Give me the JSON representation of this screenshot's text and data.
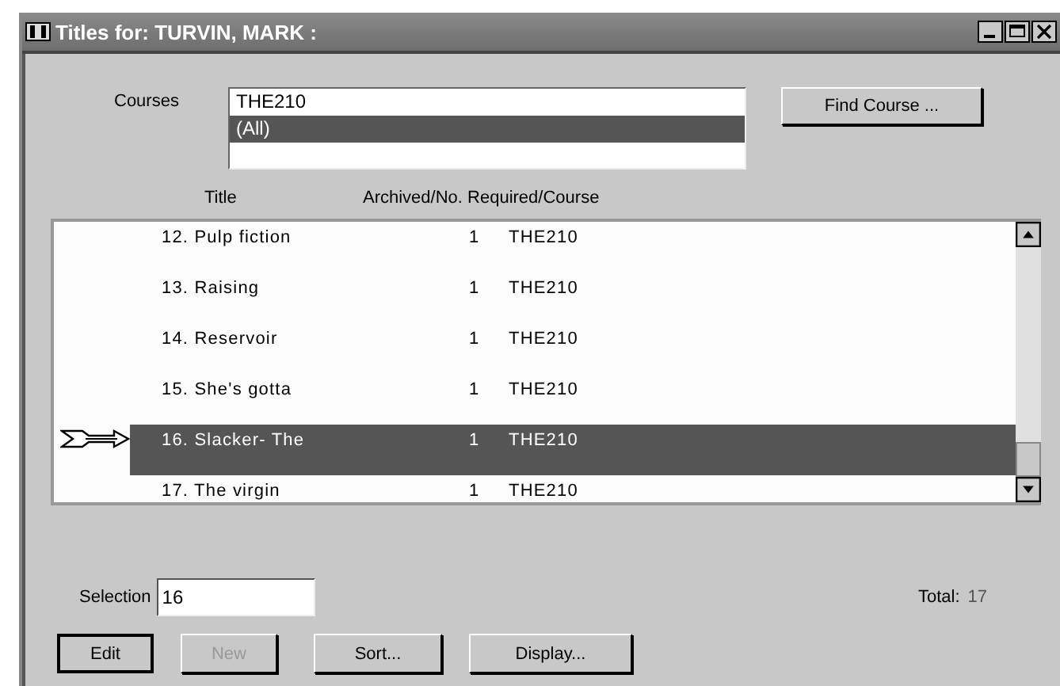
{
  "window": {
    "title": "Titles for: TURVIN, MARK :"
  },
  "courses": {
    "label": "Courses",
    "items": [
      {
        "text": "THE210",
        "selected": false
      },
      {
        "text": "(All)",
        "selected": true
      }
    ]
  },
  "find_button": {
    "label": "Find Course ..."
  },
  "columns": [
    "Title",
    "Archived/No. Required/Course"
  ],
  "rows": [
    {
      "title": "12. Pulp fiction",
      "count": "1",
      "course": "THE210",
      "selected": false
    },
    {
      "title": "13. Raising",
      "count": "1",
      "course": "THE210",
      "selected": false
    },
    {
      "title": "14. Reservoir",
      "count": "1",
      "course": "THE210",
      "selected": false
    },
    {
      "title": "15. She's gotta",
      "count": "1",
      "course": "THE210",
      "selected": false
    },
    {
      "title": "16. Slacker- The",
      "count": "1",
      "course": "THE210",
      "selected": true
    },
    {
      "title": "17. The virgin",
      "count": "1",
      "course": "THE210",
      "selected": false
    }
  ],
  "selection": {
    "label": "Selection",
    "value": "16"
  },
  "total": {
    "label": "Total:",
    "value": "17"
  },
  "buttons": [
    {
      "label": "Edit",
      "default": true,
      "disabled": false
    },
    {
      "label": "New",
      "default": false,
      "disabled": true
    },
    {
      "label": "Sort...",
      "default": false,
      "disabled": false
    },
    {
      "label": "Display...",
      "default": false,
      "disabled": false
    }
  ]
}
